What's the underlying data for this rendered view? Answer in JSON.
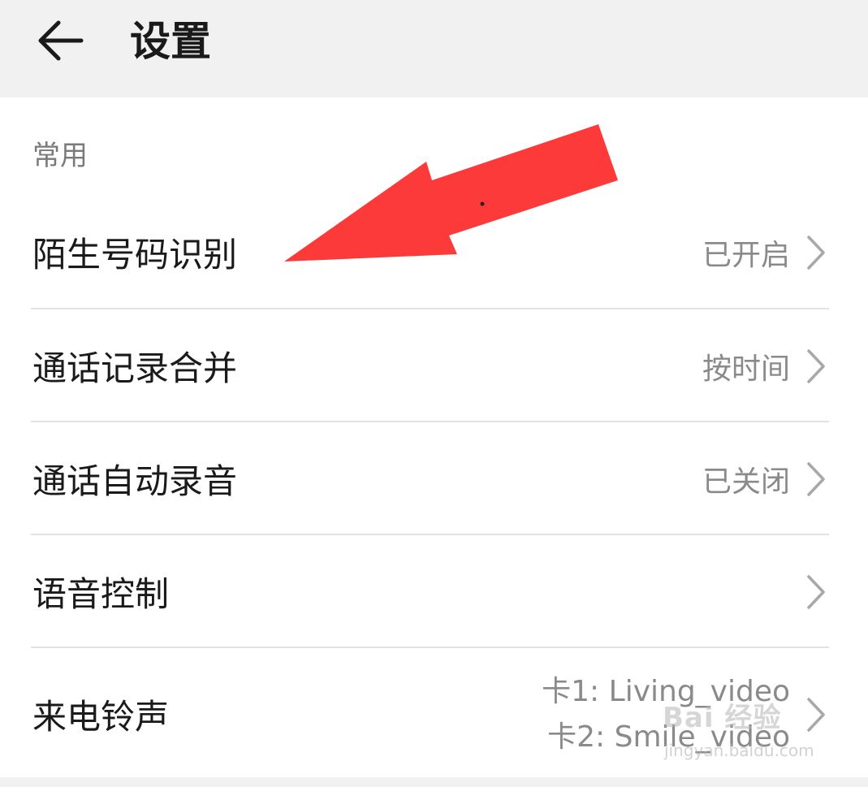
{
  "header": {
    "title": "设置",
    "back_icon": "arrow-left-icon"
  },
  "section": {
    "label": "常用"
  },
  "rows": [
    {
      "label": "陌生号码识别",
      "value": "已开启"
    },
    {
      "label": "通话记录合并",
      "value": "按时间"
    },
    {
      "label": "通话自动录音",
      "value": "已关闭"
    },
    {
      "label": "语音控制",
      "value": ""
    },
    {
      "label": "来电铃声",
      "value_line1": "卡1: Living_video",
      "value_line2": "卡2: Smile_video"
    }
  ],
  "annotation": {
    "arrow_color": "#fc3a3a"
  },
  "watermark": {
    "brand": "Bai 经验",
    "url": "jingyan.baidu.com"
  }
}
